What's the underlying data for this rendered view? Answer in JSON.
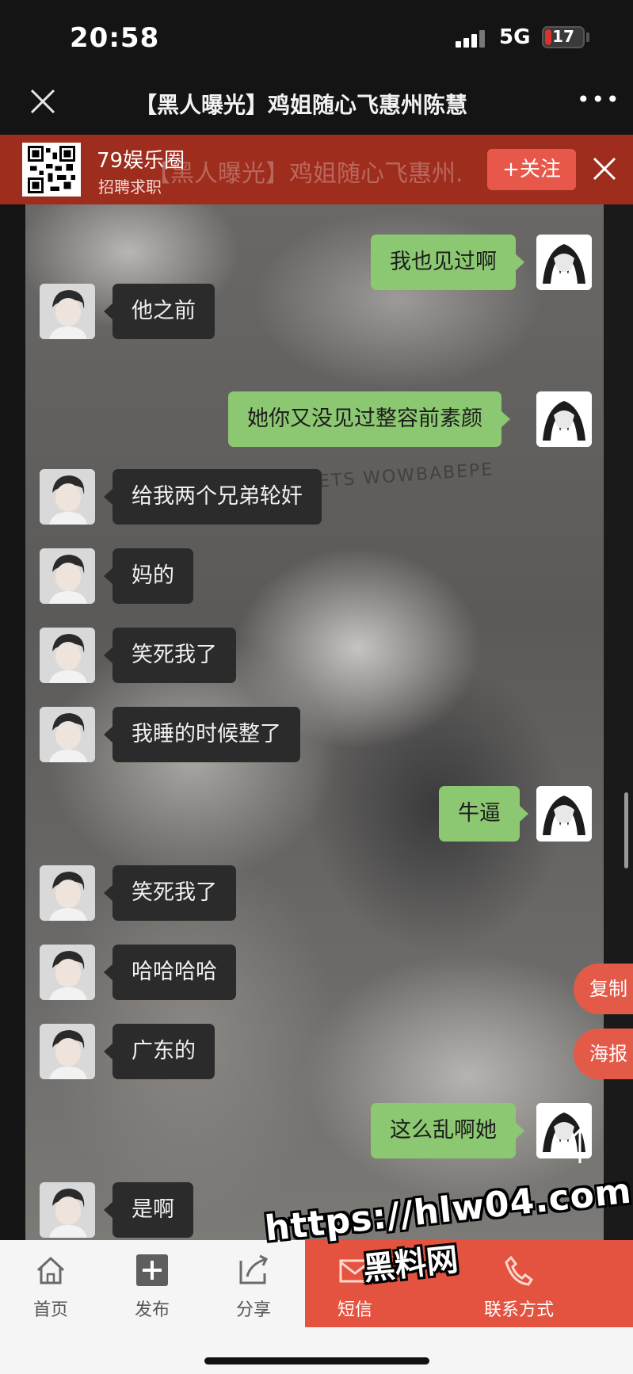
{
  "status_bar": {
    "time": "20:58",
    "network": "5G",
    "battery_level": "17",
    "battery_fraction": 0.17
  },
  "nav": {
    "title": "【黑人曝光】鸡姐随心飞惠州陈慧",
    "more": "•••"
  },
  "banner": {
    "ghost_title": "【黑人曝光】鸡姐随心飞惠州.",
    "name": "79娱乐圈",
    "subtitle": "招聘求职",
    "follow_label": "+关注"
  },
  "background": {
    "watermark_text": "ETS  WOWBABEPE"
  },
  "messages": [
    {
      "side": "self",
      "text": "我也见过啊"
    },
    {
      "side": "other",
      "text": "他之前"
    },
    {
      "side": "self",
      "text": "她你又没见过整容前素颜"
    },
    {
      "side": "other",
      "text": "给我两个兄弟轮奸"
    },
    {
      "side": "other",
      "text": "妈的"
    },
    {
      "side": "other",
      "text": "笑死我了"
    },
    {
      "side": "other",
      "text": "我睡的时候整了"
    },
    {
      "side": "self",
      "text": "牛逼"
    },
    {
      "side": "other",
      "text": "笑死我了"
    },
    {
      "side": "other",
      "text": "哈哈哈哈"
    },
    {
      "side": "other",
      "text": "广东的"
    },
    {
      "side": "self",
      "text": "这么乱啊她"
    },
    {
      "side": "other",
      "text": "是啊"
    }
  ],
  "side_buttons": {
    "copy": "复制",
    "poster": "海报"
  },
  "tabs": {
    "home": "首页",
    "publish": "发布",
    "share": "分享",
    "sms": "短信",
    "contact": "联系方式"
  },
  "watermark": {
    "url": "https://hlw04.com",
    "name": "黑料网"
  },
  "colors": {
    "accent": "#e4533f",
    "banner": "#9e2d1e",
    "self_bubble": "#8cc872",
    "other_bubble": "#2b2b2b"
  }
}
